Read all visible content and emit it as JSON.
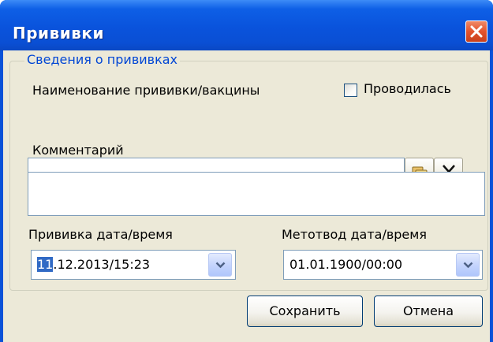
{
  "window": {
    "title": "Прививки"
  },
  "group": {
    "legend": "Сведения о прививках",
    "vaccine_label": "Наименование прививки/вакцины",
    "vaccine_value": "",
    "performed_label": "Проводилась",
    "performed_checked": false,
    "comment_label": "Комментарий",
    "comment_value": ""
  },
  "vaccination_date": {
    "label": "Прививка дата/время",
    "selected_part": "11",
    "rest": ".12.2013/15:23"
  },
  "medical_exemption_date": {
    "label": "Метотвод дата/время",
    "value": "01.01.1900/00:00"
  },
  "buttons": {
    "save": "Сохранить",
    "cancel": "Отмена"
  },
  "icons": {
    "close": "close-icon",
    "select": "folder-browse-icon",
    "clear": "clear-x-icon",
    "dropdown": "chevron-down-icon"
  },
  "colors": {
    "title_bar": "#0a53dc",
    "client_bg": "#ece9d8",
    "legend_text": "#0046d5",
    "close_button": "#e2532d",
    "selection": "#316ac5"
  }
}
